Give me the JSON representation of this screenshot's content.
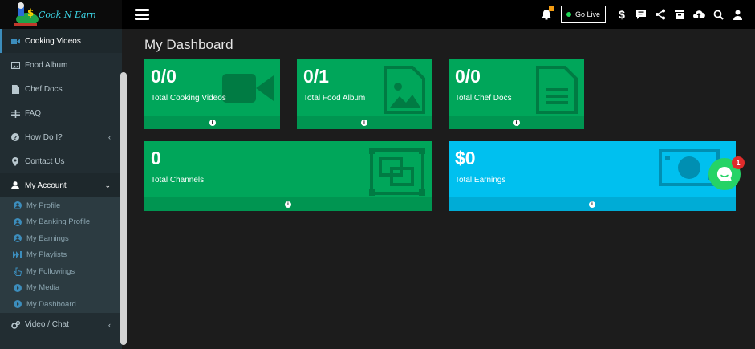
{
  "brand": {
    "name": "Cook N Earn"
  },
  "topbar": {
    "go_live_label": "Go Live",
    "dollar_glyph": "$"
  },
  "sidebar": {
    "items": [
      {
        "label": "Cooking Videos",
        "icon": "video-icon"
      },
      {
        "label": "Food Album",
        "icon": "image-icon"
      },
      {
        "label": "Chef Docs",
        "icon": "document-icon"
      },
      {
        "label": "FAQ",
        "icon": "faq-icon"
      },
      {
        "label": "How Do I?",
        "icon": "question-icon"
      },
      {
        "label": "Contact Us",
        "icon": "location-pin-icon"
      },
      {
        "label": "My Account",
        "icon": "user-icon"
      }
    ],
    "account_sub": [
      {
        "label": "My Profile",
        "icon": "user-circle-icon"
      },
      {
        "label": "My Banking Profile",
        "icon": "user-circle-icon"
      },
      {
        "label": "My Earnings",
        "icon": "user-circle-icon"
      },
      {
        "label": "My Playlists",
        "icon": "playlist-icon"
      },
      {
        "label": "My Followings",
        "icon": "hand-pointer-icon"
      },
      {
        "label": "My Media",
        "icon": "play-circle-icon"
      },
      {
        "label": "My Dashboard",
        "icon": "play-circle-icon"
      }
    ],
    "video_chat": {
      "label": "Video / Chat",
      "icon": "cogs-icon"
    }
  },
  "main": {
    "title": "My Dashboard",
    "boxes": [
      {
        "value": "0/0",
        "label": "Total Cooking Videos",
        "icon": "video-camera-icon"
      },
      {
        "value": "0/1",
        "label": "Total Food Album",
        "icon": "file-image-icon"
      },
      {
        "value": "0/0",
        "label": "Total Chef Docs",
        "icon": "file-text-icon"
      },
      {
        "value": "0",
        "label": "Total Channels",
        "icon": "object-group-icon"
      },
      {
        "value": "$0",
        "label": "Total Earnings",
        "icon": "money-icon"
      }
    ]
  },
  "chat": {
    "badge": "1"
  },
  "colors": {
    "green": "#00a65a",
    "aqua": "#00c0ef",
    "sidebar": "#222d32",
    "accent": "#3c8dbc"
  }
}
